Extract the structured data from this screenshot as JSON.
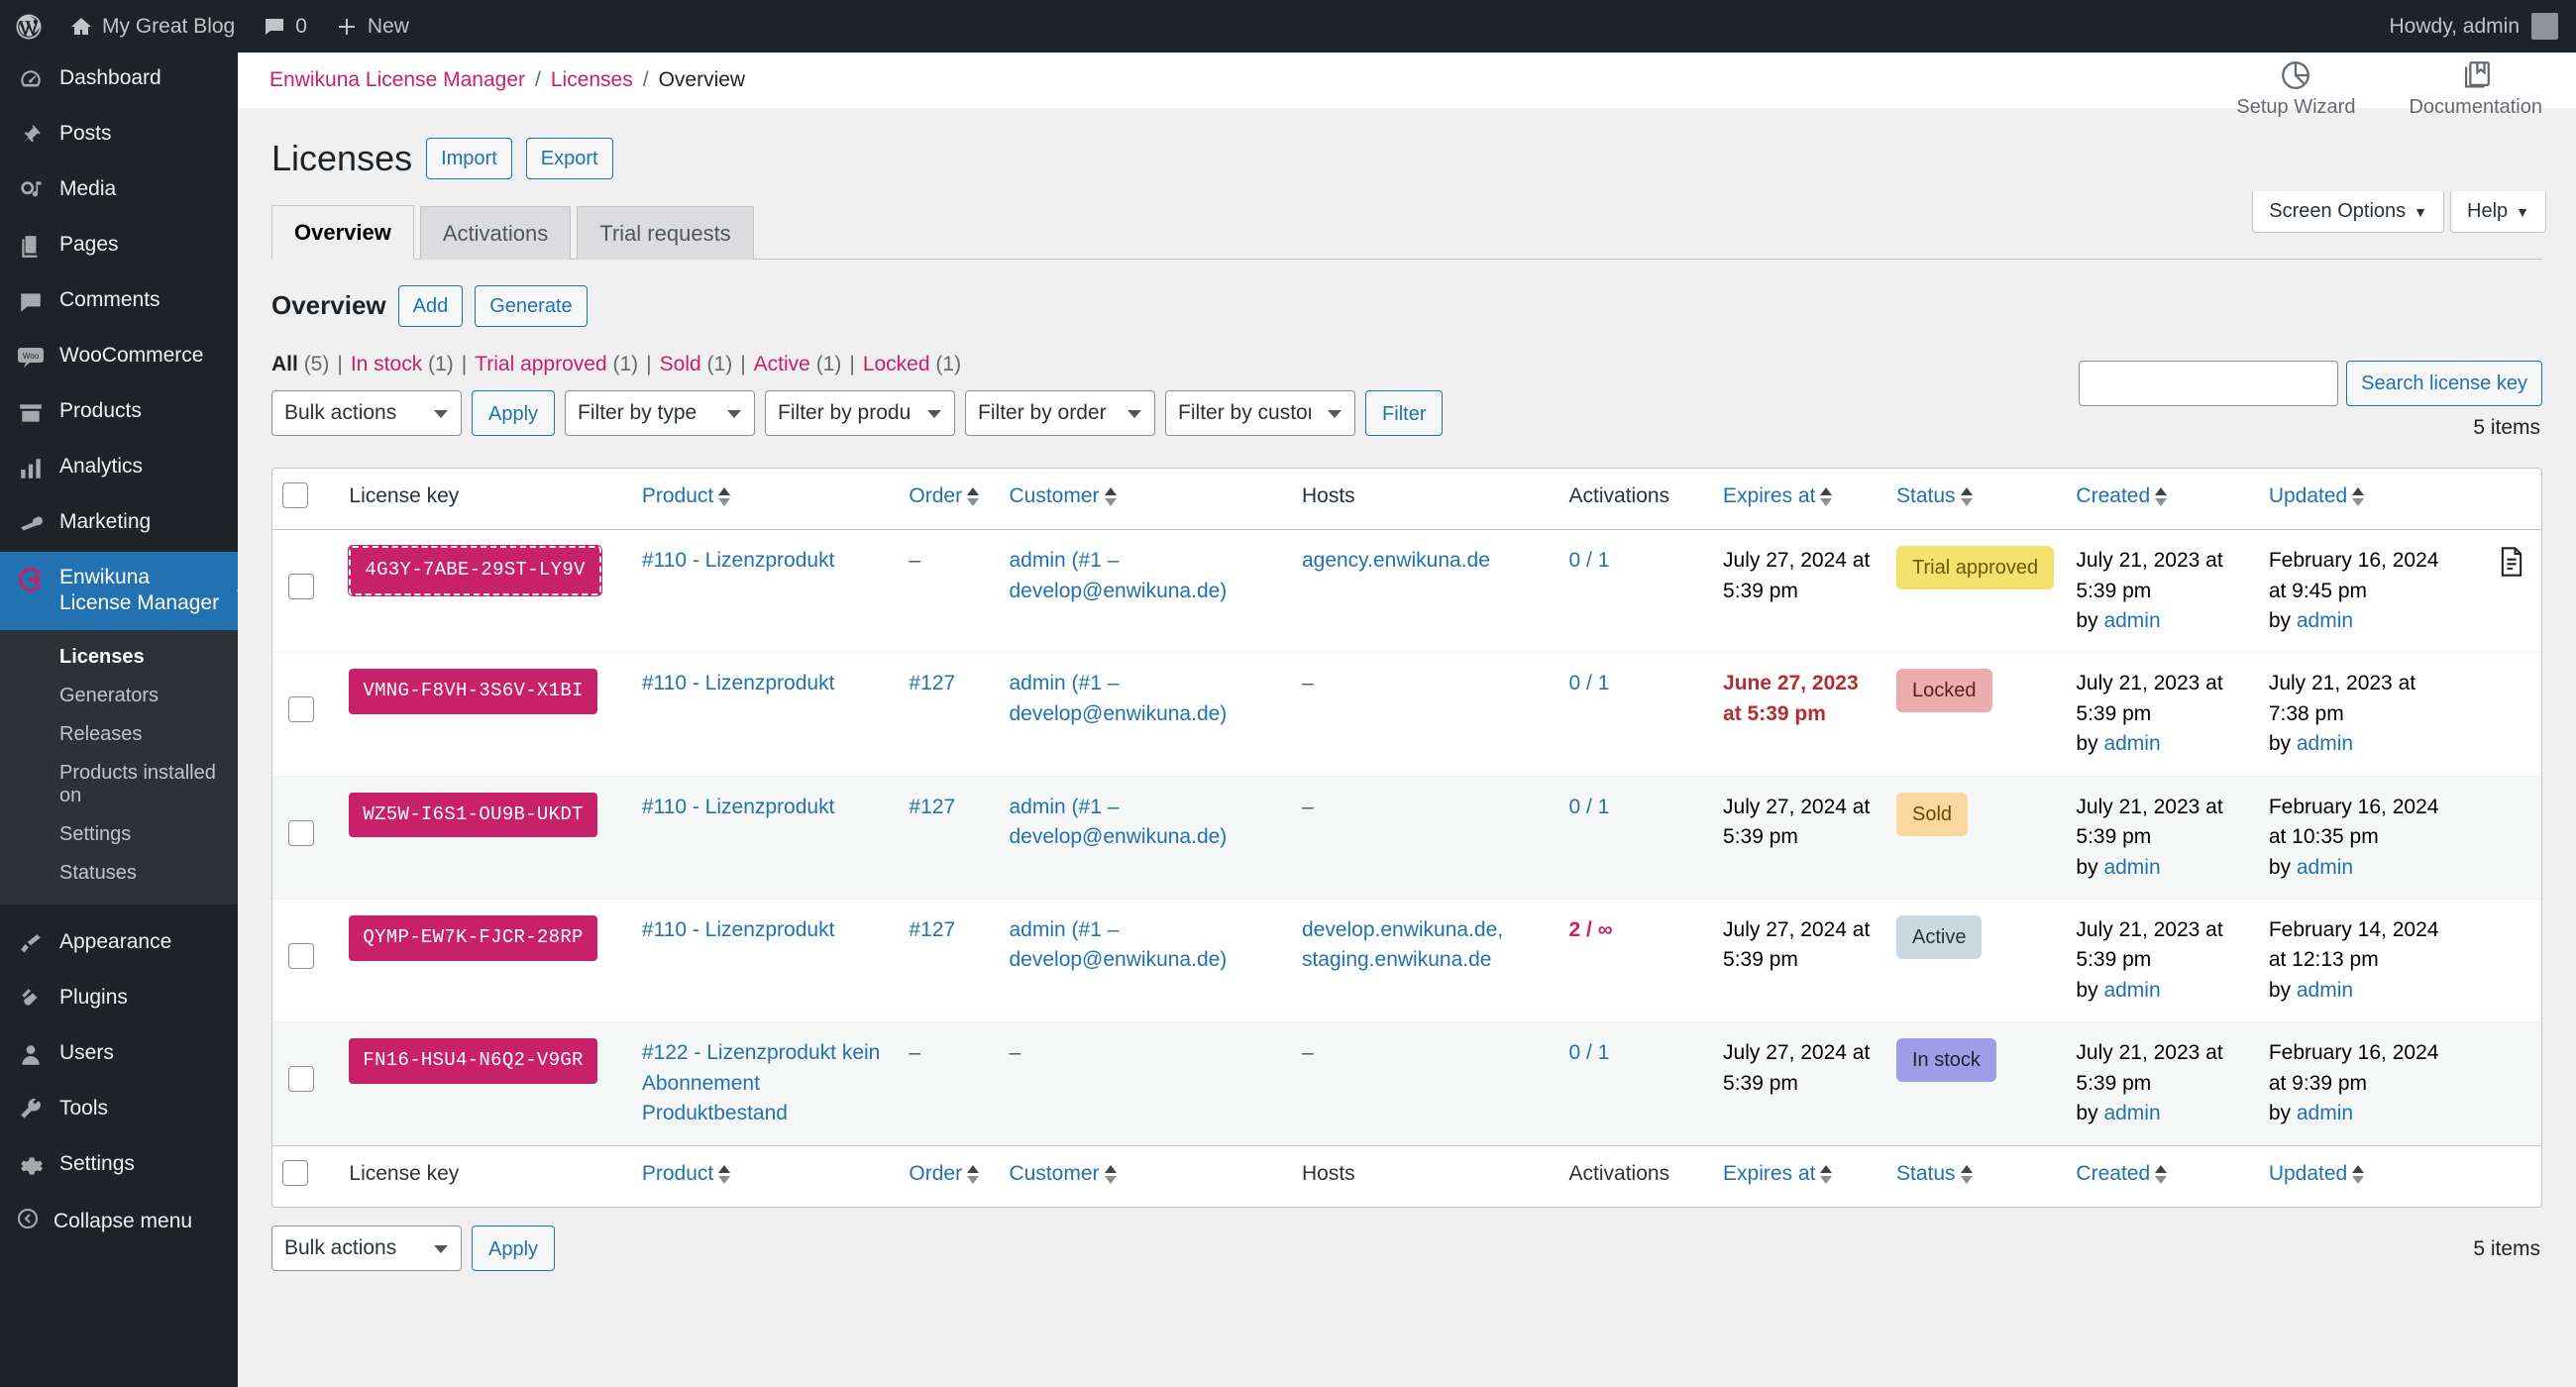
{
  "adminbar": {
    "site_name": "My Great Blog",
    "comments_count": "0",
    "new_label": "New",
    "howdy": "Howdy, admin"
  },
  "sidebar": {
    "items": [
      {
        "label": "Dashboard",
        "icon": "dashboard-icon"
      },
      {
        "label": "Posts",
        "icon": "pin-icon"
      },
      {
        "label": "Media",
        "icon": "media-icon"
      },
      {
        "label": "Pages",
        "icon": "pages-icon"
      },
      {
        "label": "Comments",
        "icon": "comments-icon"
      },
      {
        "label": "WooCommerce",
        "icon": "woo-icon"
      },
      {
        "label": "Products",
        "icon": "products-icon"
      },
      {
        "label": "Analytics",
        "icon": "analytics-icon"
      },
      {
        "label": "Marketing",
        "icon": "marketing-icon"
      }
    ],
    "current": {
      "label": "Enwikuna License Manager",
      "icon": "enwikuna-icon"
    },
    "submenu": [
      {
        "label": "Licenses",
        "current": true
      },
      {
        "label": "Generators",
        "current": false
      },
      {
        "label": "Releases",
        "current": false
      },
      {
        "label": "Products installed on",
        "current": false
      },
      {
        "label": "Settings",
        "current": false
      },
      {
        "label": "Statuses",
        "current": false
      }
    ],
    "items_after": [
      {
        "label": "Appearance",
        "icon": "brush-icon"
      },
      {
        "label": "Plugins",
        "icon": "plugin-icon"
      },
      {
        "label": "Users",
        "icon": "user-icon"
      },
      {
        "label": "Tools",
        "icon": "wrench-icon"
      },
      {
        "label": "Settings",
        "icon": "gear-icon"
      }
    ],
    "collapse_label": "Collapse menu"
  },
  "breadcrumb": {
    "root": "Enwikuna License Manager",
    "second": "Licenses",
    "current": "Overview",
    "sep": "/"
  },
  "page_actions": {
    "setup_wizard": "Setup Wizard",
    "documentation": "Documentation",
    "screen_options": "Screen Options",
    "help": "Help"
  },
  "header": {
    "title": "Licenses",
    "import_label": "Import",
    "export_label": "Export"
  },
  "tabs": [
    {
      "label": "Overview",
      "active": true
    },
    {
      "label": "Activations",
      "active": false
    },
    {
      "label": "Trial requests",
      "active": false
    }
  ],
  "subheader": {
    "title": "Overview",
    "add_label": "Add",
    "generate_label": "Generate"
  },
  "status_filters": [
    {
      "label": "All",
      "count": "(5)",
      "current": true
    },
    {
      "label": "In stock",
      "count": "(1)",
      "current": false
    },
    {
      "label": "Trial approved",
      "count": "(1)",
      "current": false
    },
    {
      "label": "Sold",
      "count": "(1)",
      "current": false
    },
    {
      "label": "Active",
      "count": "(1)",
      "current": false
    },
    {
      "label": "Locked",
      "count": "(1)",
      "current": false
    }
  ],
  "tablenav": {
    "bulk_actions": "Bulk actions",
    "apply_label": "Apply",
    "filter_type": "Filter by type",
    "filter_product": "Filter by product",
    "filter_order": "Filter by order",
    "filter_customer": "Filter by customer",
    "filter_label": "Filter",
    "search_value": "",
    "search_button": "Search license key",
    "items_count": "5 items"
  },
  "columns": {
    "license_key": "License key",
    "product": "Product",
    "order": "Order",
    "customer": "Customer",
    "hosts": "Hosts",
    "activations": "Activations",
    "expires_at": "Expires at",
    "status": "Status",
    "created": "Created",
    "updated": "Updated"
  },
  "rows": [
    {
      "license_key": "4G3Y-7ABE-29ST-LY9V",
      "key_hidden": true,
      "product": "#110 - Lizenzprodukt",
      "order": "–",
      "customer": "admin (#1 – develop@enwikuna.de)",
      "hosts": "agency.enwikuna.de",
      "activations": "0 / 1",
      "activations_infinite": false,
      "expires_at": "July 27, 2024 at 5:39 pm",
      "expired": false,
      "status": "Trial approved",
      "status_class": "st-trial",
      "created": "July 21, 2023 at 5:39 pm",
      "created_by_prefix": "by",
      "created_by": "admin",
      "updated": "February 16, 2024 at 9:45 pm",
      "updated_by_prefix": "by",
      "updated_by": "admin",
      "has_doc_icon": true
    },
    {
      "license_key": "VMNG-F8VH-3S6V-X1BI",
      "key_hidden": false,
      "product": "#110 - Lizenzprodukt",
      "order": "#127",
      "customer": "admin (#1 – develop@enwikuna.de)",
      "hosts": "–",
      "activations": "0 / 1",
      "activations_infinite": false,
      "expires_at": "June 27, 2023 at 5:39 pm",
      "expired": true,
      "status": "Locked",
      "status_class": "st-locked",
      "created": "July 21, 2023 at 5:39 pm",
      "created_by_prefix": "by",
      "created_by": "admin",
      "updated": "July 21, 2023 at 7:38 pm",
      "updated_by_prefix": "by",
      "updated_by": "admin",
      "has_doc_icon": false
    },
    {
      "license_key": "WZ5W-I6S1-OU9B-UKDT",
      "key_hidden": false,
      "product": "#110 - Lizenzprodukt",
      "order": "#127",
      "customer": "admin (#1 – develop@enwikuna.de)",
      "hosts": "–",
      "activations": "0 / 1",
      "activations_infinite": false,
      "expires_at": "July 27, 2024 at 5:39 pm",
      "expired": false,
      "status": "Sold",
      "status_class": "st-sold",
      "created": "July 21, 2023 at 5:39 pm",
      "created_by_prefix": "by",
      "created_by": "admin",
      "updated": "February 16, 2024 at 10:35 pm",
      "updated_by_prefix": "by",
      "updated_by": "admin",
      "has_doc_icon": false
    },
    {
      "license_key": "QYMP-EW7K-FJCR-28RP",
      "key_hidden": false,
      "product": "#110 - Lizenzprodukt",
      "order": "#127",
      "customer": "admin (#1 – develop@enwikuna.de)",
      "hosts": "develop.enwikuna.de, staging.enwikuna.de",
      "activations": "2 / ∞",
      "activations_infinite": true,
      "expires_at": "July 27, 2024 at 5:39 pm",
      "expired": false,
      "status": "Active",
      "status_class": "st-active",
      "created": "July 21, 2023 at 5:39 pm",
      "created_by_prefix": "by",
      "created_by": "admin",
      "updated": "February 14, 2024 at 12:13 pm",
      "updated_by_prefix": "by",
      "updated_by": "admin",
      "has_doc_icon": false
    },
    {
      "license_key": "FN16-HSU4-N6Q2-V9GR",
      "key_hidden": false,
      "product": "#122 - Lizenzprodukt kein Abonnement Produktbestand",
      "order": "–",
      "customer": "–",
      "hosts": "–",
      "activations": "0 / 1",
      "activations_infinite": false,
      "expires_at": "July 27, 2024 at 5:39 pm",
      "expired": false,
      "status": "In stock",
      "status_class": "st-instock",
      "created": "July 21, 2023 at 5:39 pm",
      "created_by_prefix": "by",
      "created_by": "admin",
      "updated": "February 16, 2024 at 9:39 pm",
      "updated_by_prefix": "by",
      "updated_by": "admin",
      "has_doc_icon": false
    }
  ],
  "colors": {
    "brand_pink": "#c9206a",
    "link_blue": "#2271b1",
    "admin_dark": "#1d2327",
    "current_blue": "#2271b1"
  }
}
